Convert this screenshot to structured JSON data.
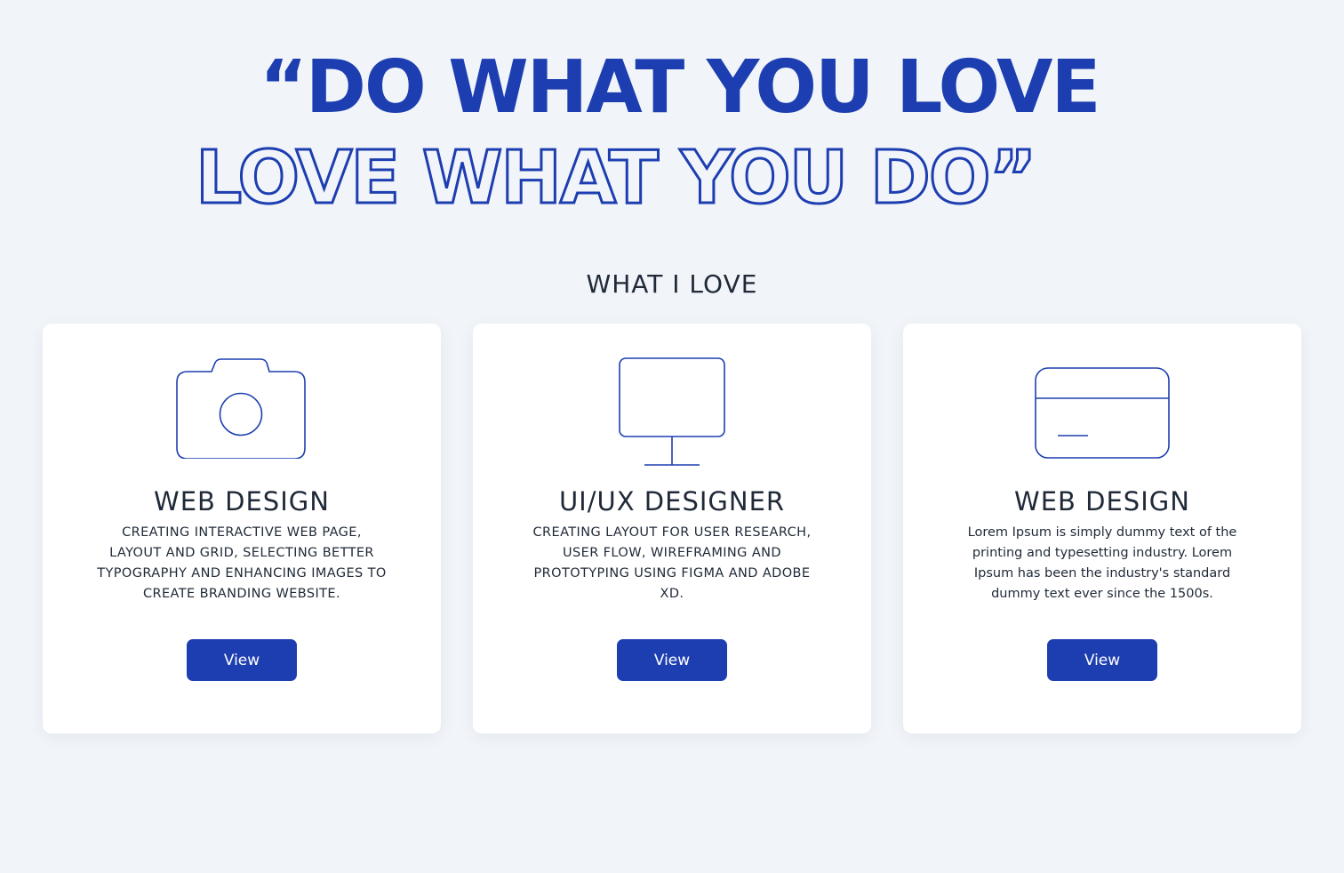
{
  "hero": {
    "line1": "“DO WHAT YOU LOVE",
    "line2": "LOVE WHAT YOU DO”"
  },
  "section": {
    "title": "WHAT I LOVE"
  },
  "colors": {
    "accent": "#1d3eb0",
    "background": "#f1f4f9",
    "card": "#ffffff",
    "text": "#1f2937"
  },
  "cards": [
    {
      "icon": "camera-icon",
      "title": "WEB DESIGN",
      "description": "CREATING INTERACTIVE WEB PAGE, LAYOUT AND GRID, SELECTING BETTER TYPOGRAPHY AND ENHANCING IMAGES TO CREATE BRANDING WEBSITE.",
      "button_label": "View"
    },
    {
      "icon": "monitor-icon",
      "title": "UI/UX DESIGNER",
      "description": "CREATING LAYOUT FOR USER RESEARCH, USER FLOW, WIREFRAMING AND PROTOTYPING USING FIGMA AND ADOBE XD.",
      "button_label": "View"
    },
    {
      "icon": "credit-card-icon",
      "title": "WEB DESIGN",
      "description": "Lorem Ipsum is simply dummy text of the printing and typesetting industry. Lorem Ipsum has been the industry's standard dummy text ever since the 1500s.",
      "button_label": "View"
    }
  ]
}
